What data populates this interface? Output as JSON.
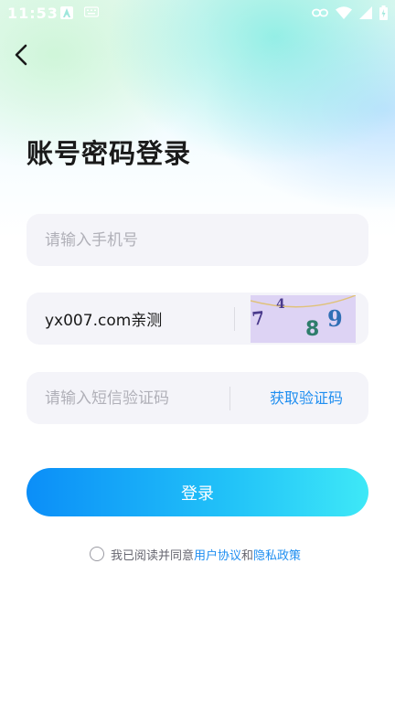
{
  "status_bar": {
    "time": "11:53"
  },
  "header": {
    "title": "账号密码登录"
  },
  "form": {
    "phone_placeholder": "请输入手机号",
    "captcha_value": "yx007.com亲测",
    "captcha_chars": [
      "7",
      "4",
      "8",
      "9"
    ],
    "sms_placeholder": "请输入短信验证码",
    "sms_button_label": "获取验证码",
    "login_label": "登录"
  },
  "agreement": {
    "prefix": "我已阅读并同意",
    "user_agreement": "用户协议",
    "joiner": "和",
    "privacy_policy": "隐私政策"
  },
  "colors": {
    "accent": "#1f8ef0",
    "button_gradient_start": "#0b8ef8",
    "button_gradient_end": "#3ee8f7",
    "field_bg": "#f4f4f9"
  },
  "icons": [
    "back-arrow-icon",
    "wifi-icon",
    "signal-icon",
    "battery-icon",
    "link-icon",
    "notification-a-icon",
    "keyboard-icon"
  ]
}
